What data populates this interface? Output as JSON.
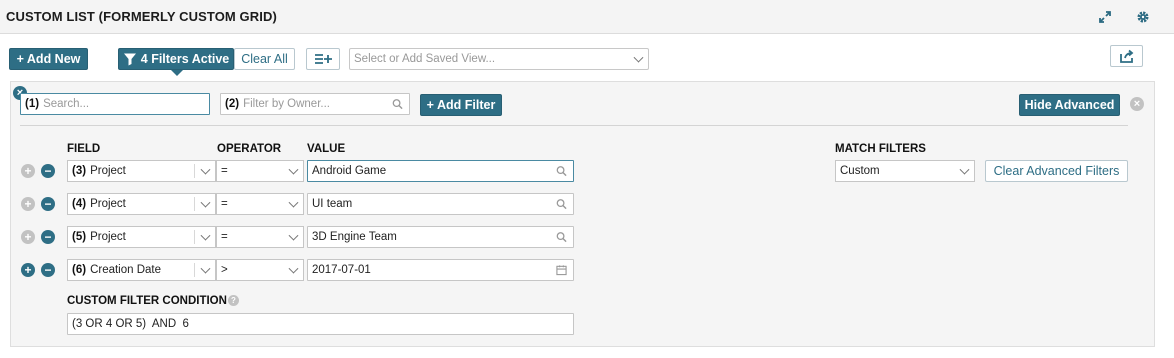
{
  "header": {
    "title": "CUSTOM LIST (FORMERLY CUSTOM GRID)"
  },
  "toolbar": {
    "add_new_label": "+ Add New",
    "filters_active_label": "4 Filters Active",
    "clear_all_label": "Clear All",
    "saved_view_placeholder": "Select or Add Saved View..."
  },
  "filter_bar": {
    "search": {
      "number": "(1)",
      "placeholder": "Search..."
    },
    "owner": {
      "number": "(2)",
      "placeholder": "Filter by Owner..."
    },
    "add_filter_label": "+ Add Filter",
    "hide_advanced_label": "Hide Advanced"
  },
  "advanced": {
    "columns": {
      "field": "FIELD",
      "operator": "OPERATOR",
      "value": "VALUE"
    },
    "rows": [
      {
        "number": "(3)",
        "field": "Project",
        "operator": "=",
        "value": "Android Game",
        "value_icon": "search-icon"
      },
      {
        "number": "(4)",
        "field": "Project",
        "operator": "=",
        "value": "UI team",
        "value_icon": "search-icon"
      },
      {
        "number": "(5)",
        "field": "Project",
        "operator": "=",
        "value": "3D Engine Team",
        "value_icon": "search-icon"
      },
      {
        "number": "(6)",
        "field": "Creation Date",
        "operator": ">",
        "value": "2017-07-01",
        "value_icon": "calendar-icon"
      }
    ],
    "match_filters_label": "MATCH FILTERS",
    "match_filters_value": "Custom",
    "clear_advanced_label": "Clear Advanced Filters",
    "condition_label": "CUSTOM FILTER CONDITION",
    "condition_value": "(3 OR 4 OR 5)  AND  6"
  },
  "colors": {
    "accent": "#2e6e85",
    "header_bg": "#f4f4f4",
    "panel_bg": "#f5f5f5"
  }
}
